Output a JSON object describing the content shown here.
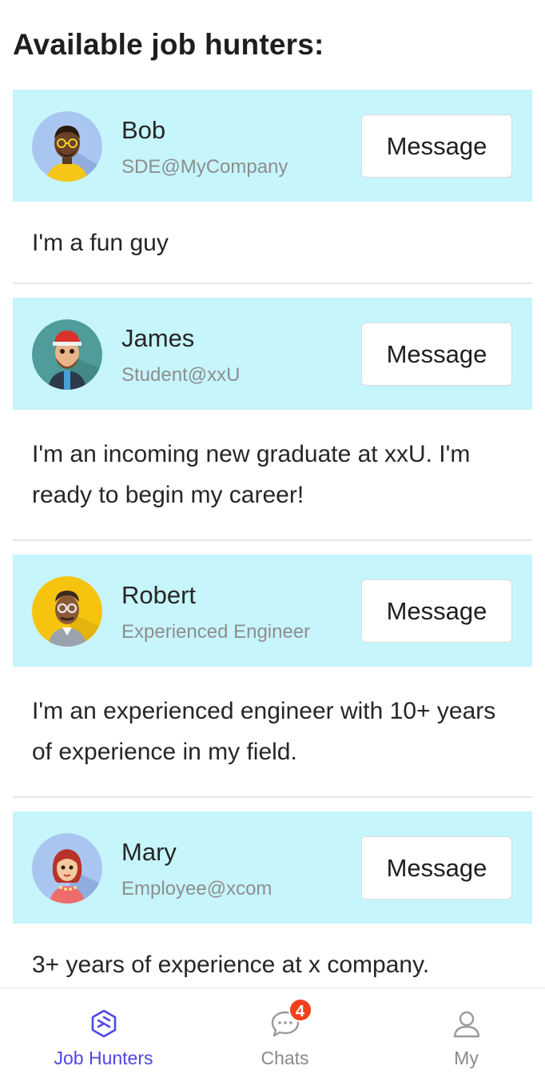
{
  "page_title": "Available job hunters:",
  "hunters": [
    {
      "name": "Bob",
      "subtitle": "SDE@MyCompany",
      "button": "Message",
      "bio": "I'm a fun guy"
    },
    {
      "name": "James",
      "subtitle": "Student@xxU",
      "button": "Message",
      "bio": "I'm an incoming new graduate at xxU. I'm ready to begin my career!"
    },
    {
      "name": "Robert",
      "subtitle": "Experienced Engineer",
      "button": "Message",
      "bio": "I'm an experienced engineer with 10+ years of experience in my field."
    },
    {
      "name": "Mary",
      "subtitle": "Employee@xcom",
      "button": "Message",
      "bio": "3+ years of experience at x company."
    }
  ],
  "tabbar": {
    "tabs": [
      {
        "label": "Job Hunters",
        "icon": "hexagon-icon",
        "active": true
      },
      {
        "label": "Chats",
        "icon": "chat-bubble-icon",
        "badge": "4",
        "active": false
      },
      {
        "label": "My",
        "icon": "person-icon",
        "active": false
      }
    ]
  },
  "colors": {
    "card_header": "#c6f5fb",
    "accent": "#5046e5",
    "badge": "#f0411c",
    "subtitle": "#8e8e8e"
  }
}
